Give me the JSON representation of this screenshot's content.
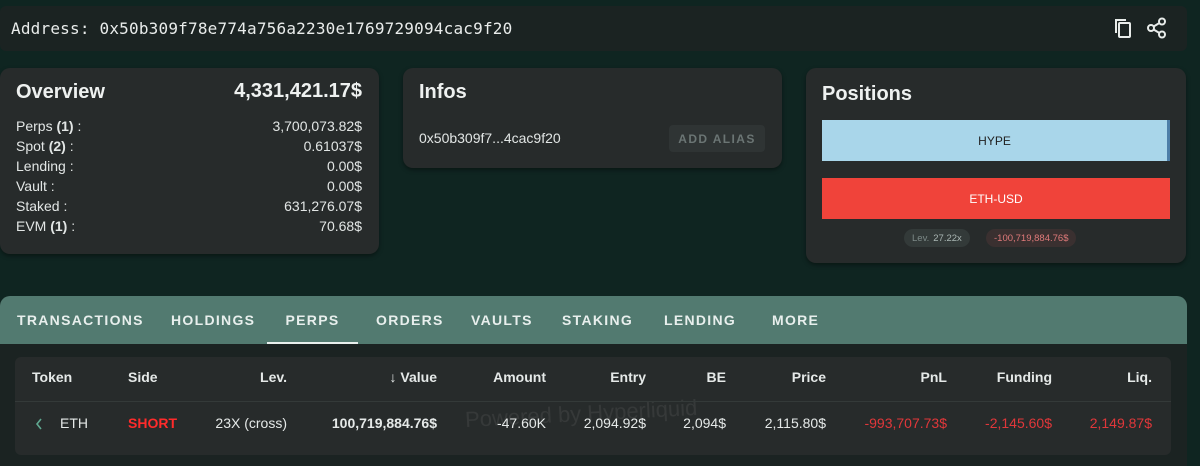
{
  "address": {
    "text": "Address: 0x50b309f78e774a756a2230e1769729094cac9f20",
    "copy_icon": "copy-icon",
    "share_icon": "share-icon"
  },
  "overview": {
    "title": "Overview",
    "total": "4,331,421.17$",
    "rows": [
      {
        "label": "Perps",
        "count": "(1)",
        "suffix": " :",
        "value": "3,700,073.82$"
      },
      {
        "label": "Spot",
        "count": "(2)",
        "suffix": " :",
        "value": "0.61037$"
      },
      {
        "label": "Lending :",
        "count": "",
        "suffix": "",
        "value": "0.00$"
      },
      {
        "label": "Vault :",
        "count": "",
        "suffix": "",
        "value": "0.00$"
      },
      {
        "label": "Staked :",
        "count": "",
        "suffix": "",
        "value": "631,276.07$"
      },
      {
        "label": "EVM",
        "count": "(1)",
        "suffix": " :",
        "value": "70.68$"
      }
    ]
  },
  "infos": {
    "title": "Infos",
    "short_address": "0x50b309f7...4cac9f20",
    "add_alias": "ADD ALIAS"
  },
  "positions": {
    "title": "Positions",
    "bars": [
      {
        "label": "HYPE",
        "color": "#a9d6ea"
      },
      {
        "label": "ETH-USD",
        "color": "#f0433a"
      }
    ],
    "lev_label": "Lev.",
    "lev_value": "27.22x",
    "pnl": "-100,719,884.76$"
  },
  "tabs": [
    "TRANSACTIONS",
    "HOLDINGS",
    "PERPS",
    "ORDERS",
    "VAULTS",
    "STAKING",
    "LENDING",
    "MORE"
  ],
  "active_tab": "PERPS",
  "table": {
    "headers": [
      "Token",
      "Side",
      "Lev.",
      "Value",
      "Amount",
      "Entry",
      "BE",
      "Price",
      "PnL",
      "Funding",
      "Liq."
    ],
    "sort_icon": "arrow-down-icon",
    "rows": [
      [
        "ETH",
        "SHORT",
        "23X (cross)",
        "100,719,884.76$",
        "-47.60K",
        "2,094.92$",
        "2,094$",
        "2,115.80$",
        "-993,707.73$",
        "-2,145.60$",
        "2,149.87$"
      ]
    ]
  },
  "watermark": "Powered by Hyperliquid",
  "colors": {
    "background": "#0f2521",
    "card": "#272b2b",
    "tabs": "#527a70",
    "negative": "#e0373a",
    "short": "#ff2b2b"
  }
}
